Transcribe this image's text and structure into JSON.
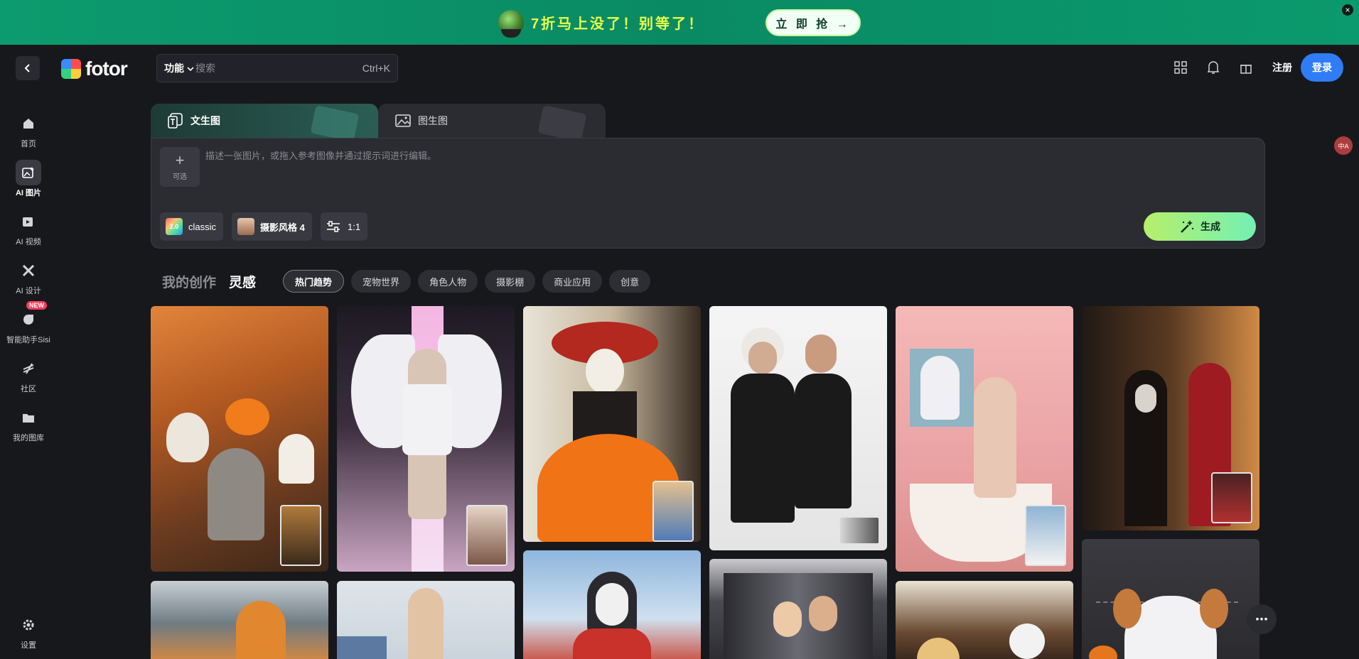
{
  "banner": {
    "promo_text": "7折马上没了！别等了！",
    "cta_label": "立 即 抢 →",
    "close_label": "×"
  },
  "topbar": {
    "logo_text": "fotor",
    "search_category": "功能",
    "search_placeholder": "搜索",
    "search_shortcut": "Ctrl+K",
    "register_label": "注册",
    "login_label": "登录"
  },
  "sidebar": {
    "items": [
      {
        "label": "首页",
        "icon": "home-icon"
      },
      {
        "label": "AI 图片",
        "icon": "ai-image-icon"
      },
      {
        "label": "AI 视频",
        "icon": "ai-video-icon"
      },
      {
        "label": "AI 设计",
        "icon": "ai-design-icon"
      },
      {
        "label": "智能助手Sisi",
        "icon": "assistant-icon",
        "badge": "NEW"
      },
      {
        "label": "社区",
        "icon": "community-icon"
      },
      {
        "label": "我的图库",
        "icon": "folder-icon"
      }
    ],
    "settings_label": "设置"
  },
  "generator": {
    "tabs": [
      {
        "label": "文生图"
      },
      {
        "label": "图生图"
      }
    ],
    "add_label": "可选",
    "prompt_placeholder": "描述一张图片，或拖入参考图像并通过提示词进行编辑。",
    "model_chip": "classic",
    "model_badge": "2.0",
    "style_chip": "摄影风格 4",
    "ratio_chip": "1:1",
    "generate_label": "生成"
  },
  "inspiration": {
    "my_creations": "我的创作",
    "inspiration": "灵感",
    "filters": [
      "热门趋势",
      "宠物世界",
      "角色人物",
      "摄影棚",
      "商业应用",
      "创意"
    ],
    "active_filter": "热门趋势"
  },
  "gallery": {
    "images": [
      {
        "subject": "halloween-cookies"
      },
      {
        "subject": "runway-angel"
      },
      {
        "subject": "day-of-dead-dress"
      },
      {
        "subject": "two-men-portrait"
      },
      {
        "subject": "pink-bathroom-ghost"
      },
      {
        "subject": "hallway-red-dress"
      },
      {
        "subject": "cat-glass-roof"
      },
      {
        "subject": "woman-outdoor"
      },
      {
        "subject": "penguin-scarf"
      },
      {
        "subject": "couple-photo-booth"
      },
      {
        "subject": "halloween-treats"
      },
      {
        "subject": "dog-ghost-costume"
      }
    ]
  },
  "fab_label": "⋯",
  "translate_label": "中A",
  "colors": {
    "accent_blue": "#2f7cf6",
    "banner_green": "#0c9b6e",
    "generate_gradient_start": "#b7ef6b",
    "generate_gradient_end": "#73f0b3",
    "background": "#17181c"
  }
}
